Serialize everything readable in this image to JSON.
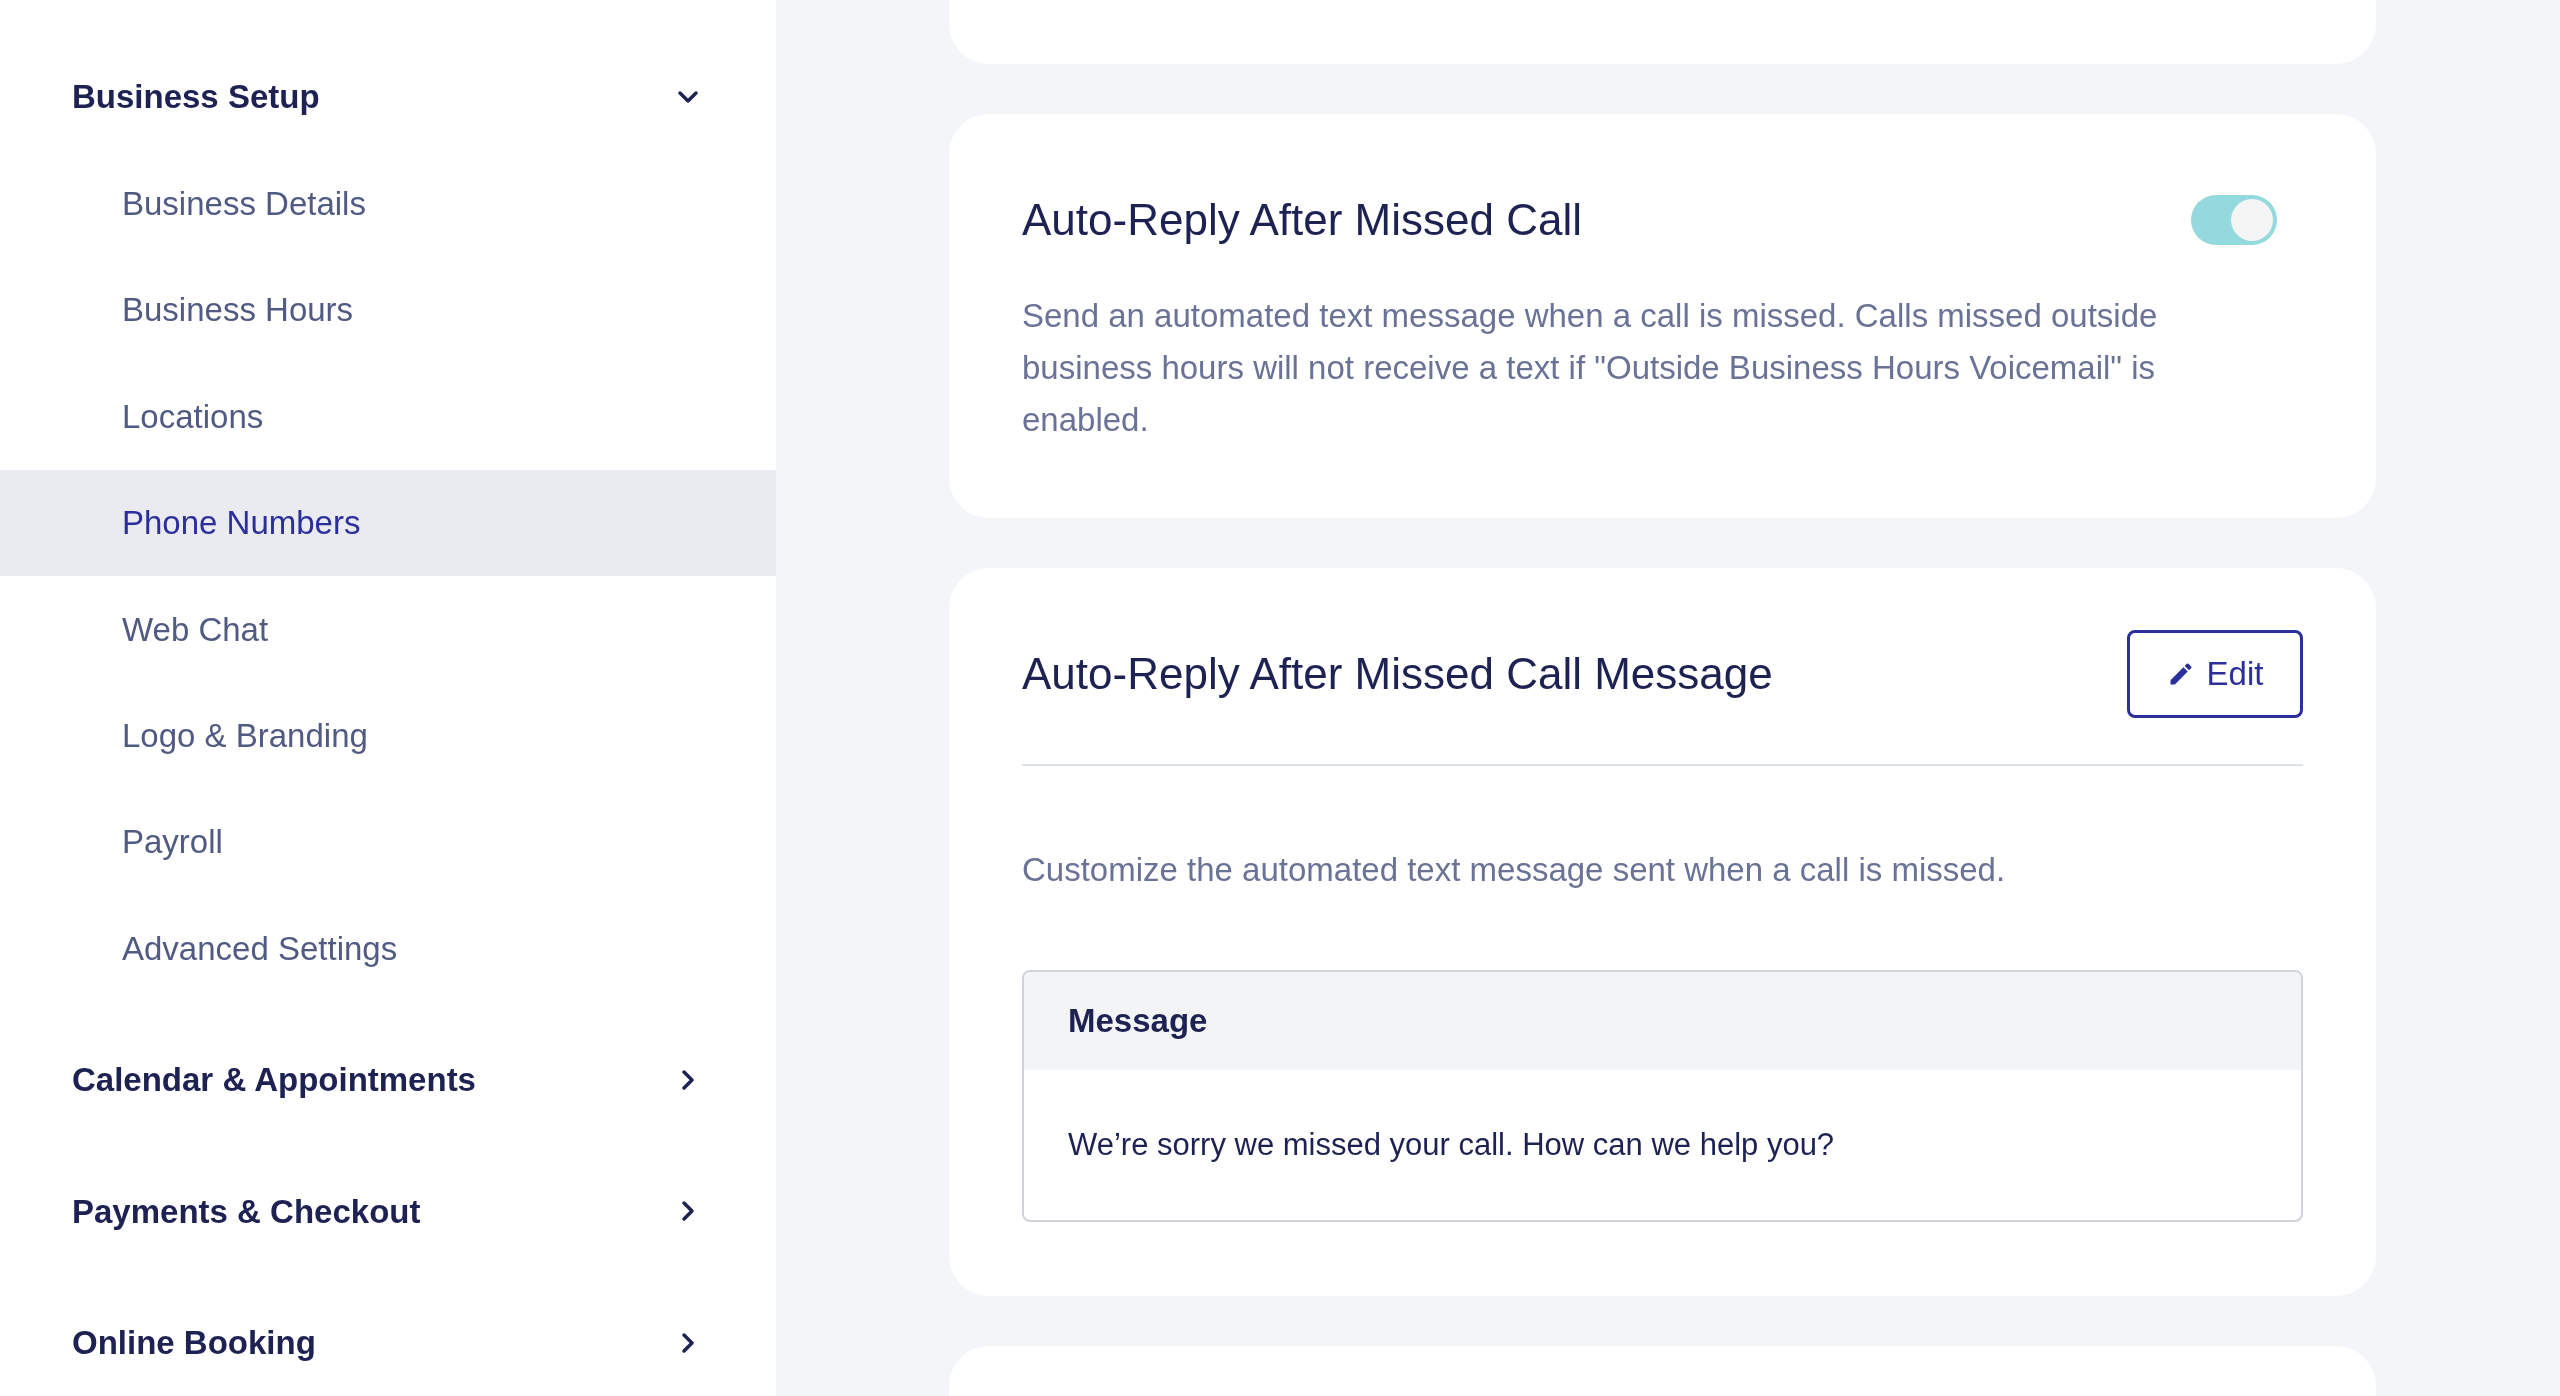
{
  "sidebar": {
    "groups": [
      {
        "label": "Business Setup",
        "expanded": true,
        "items": [
          {
            "label": "Business Details",
            "selected": false
          },
          {
            "label": "Business Hours",
            "selected": false
          },
          {
            "label": "Locations",
            "selected": false
          },
          {
            "label": "Phone Numbers",
            "selected": true
          },
          {
            "label": "Web Chat",
            "selected": false
          },
          {
            "label": "Logo & Branding",
            "selected": false
          },
          {
            "label": "Payroll",
            "selected": false
          },
          {
            "label": "Advanced Settings",
            "selected": false
          }
        ]
      },
      {
        "label": "Calendar & Appointments",
        "expanded": false
      },
      {
        "label": "Payments & Checkout",
        "expanded": false
      },
      {
        "label": "Online Booking",
        "expanded": false
      }
    ]
  },
  "cards": [
    {
      "kind": "blank"
    },
    {
      "kind": "toggle",
      "title": "Auto-Reply After Missed Call",
      "description": "Send an automated text message when a call is missed. Calls missed outside business hours will not receive a text if \"Outside Business Hours Voicemail\" is enabled.",
      "on": true
    },
    {
      "kind": "message",
      "title": "Auto-Reply After Missed Call Message",
      "edit_button": "Edit",
      "description": "Customize the automated text message sent when a call is missed.",
      "message": {
        "header": "Message",
        "text": "We’re sorry we missed your call. How can we help you?"
      }
    },
    {
      "kind": "blank"
    }
  ]
}
